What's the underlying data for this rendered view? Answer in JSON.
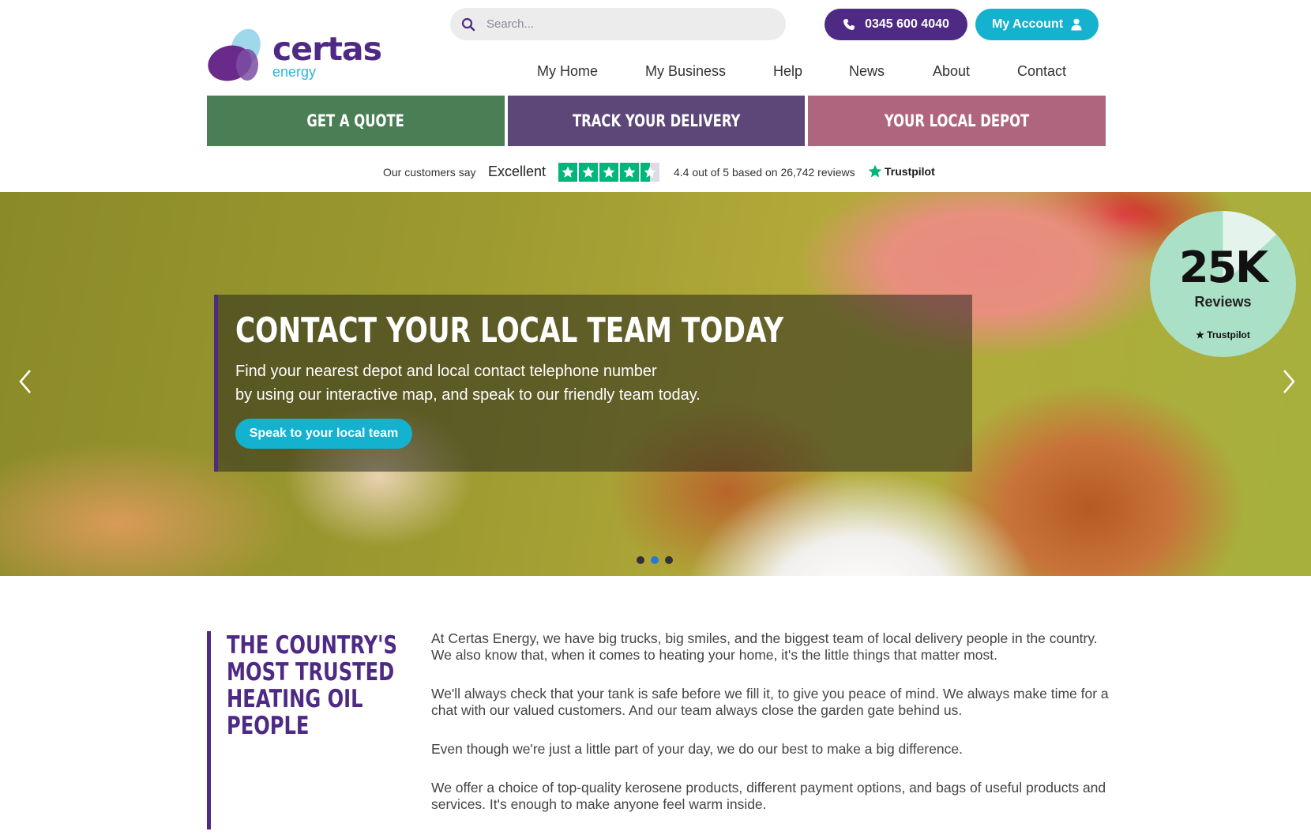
{
  "brand": {
    "name": "certas",
    "sub": "energy"
  },
  "search": {
    "placeholder": "Search..."
  },
  "header": {
    "phone_label": "0345 600 4040",
    "account_label": "My Account"
  },
  "nav": {
    "items": [
      "My Home",
      "My Business",
      "Help",
      "News",
      "About",
      "Contact"
    ]
  },
  "cta": {
    "quote": "GET A QUOTE",
    "track": "TRACK YOUR DELIVERY",
    "depot": "YOUR LOCAL DEPOT"
  },
  "trustpilot": {
    "prefix": "Our customers say",
    "verdict": "Excellent",
    "stars": 4.5,
    "rating_text": "4.4 out of 5 based on 26,742 reviews",
    "brand": "Trustpilot"
  },
  "hero": {
    "title": "CONTACT YOUR LOCAL TEAM TODAY",
    "line1": "Find your nearest depot and local contact telephone number",
    "line2": "by using our interactive map, and speak to our friendly team today.",
    "button": "Speak to your local team",
    "badge_value": "25K",
    "badge_label": "Reviews",
    "badge_brand": "Trustpilot",
    "slide_count": 3,
    "active_slide": 2
  },
  "intro": {
    "heading": [
      "THE COUNTRY'S",
      "MOST TRUSTED",
      "HEATING OIL",
      "PEOPLE"
    ],
    "paragraphs": [
      "At Certas Energy, we have big trucks, big smiles, and the biggest team of local delivery people in the country. We also know that, when it comes to heating your home, it's the little things that matter most.",
      "We'll always check that your tank is safe before we fill it, to give you peace of mind. We always make time for a chat with our valued customers. And our team always close the garden gate behind us.",
      "Even though we're just a little part of your day, we do our best to make a big difference.",
      "We offer a choice of top-quality kerosene products, different payment options, and bags of useful products and services. It's enough to make anyone feel warm inside."
    ]
  },
  "colors": {
    "purple": "#4e2a84",
    "teal": "#14b2cf",
    "green": "#4a7e54",
    "violet": "#5c4778",
    "rose": "#b0657e",
    "trustpilot_green": "#00b67a"
  }
}
